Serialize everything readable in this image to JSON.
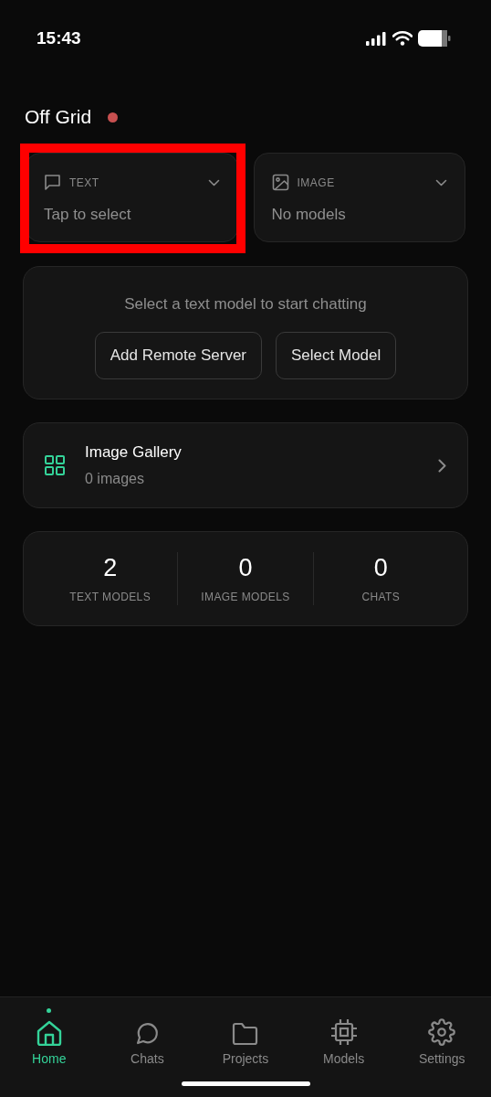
{
  "status_bar": {
    "time": "15:43"
  },
  "header": {
    "title": "Off Grid",
    "online": false
  },
  "selectors": [
    {
      "kind": "text",
      "label": "TEXT",
      "value": "Tap to select",
      "highlighted": true
    },
    {
      "kind": "image",
      "label": "IMAGE",
      "value": "No models",
      "highlighted": false
    }
  ],
  "prompt_card": {
    "message": "Select a text model to start chatting",
    "buttons": [
      "Add Remote Server",
      "Select Model"
    ]
  },
  "gallery": {
    "title": "Image Gallery",
    "subtitle": "0 images"
  },
  "stats": [
    {
      "value": "2",
      "label": "TEXT MODELS"
    },
    {
      "value": "0",
      "label": "IMAGE MODELS"
    },
    {
      "value": "0",
      "label": "CHATS"
    }
  ],
  "tab_bar": [
    {
      "kind": "home",
      "label": "Home",
      "selected": true
    },
    {
      "kind": "chats",
      "label": "Chats",
      "selected": false
    },
    {
      "kind": "projects",
      "label": "Projects",
      "selected": false
    },
    {
      "kind": "models",
      "label": "Models",
      "selected": false
    },
    {
      "kind": "settings",
      "label": "Settings",
      "selected": false
    }
  ]
}
